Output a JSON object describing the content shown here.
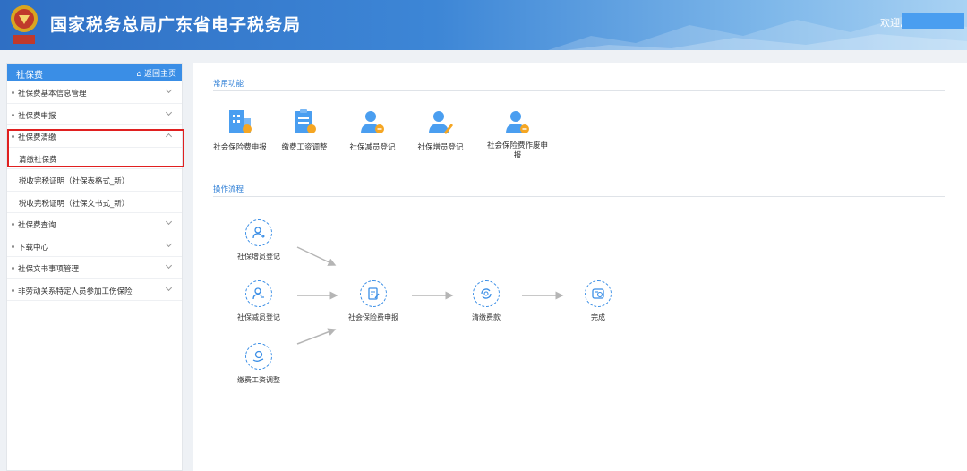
{
  "header": {
    "title": "国家税务总局广东省电子税务局",
    "welcome": "欢迎,"
  },
  "sidebar": {
    "title": "社保费",
    "home": "⌂ 返回主页",
    "items": [
      {
        "label": "社保费基本信息管理"
      },
      {
        "label": "社保费申报"
      },
      {
        "label": "社保费清缴"
      },
      {
        "label": "清缴社保费"
      },
      {
        "label": "税收完税证明（社保表格式_新）"
      },
      {
        "label": "税收完税证明（社保文书式_新）"
      },
      {
        "label": "社保费查询"
      },
      {
        "label": "下载中心"
      },
      {
        "label": "社保文书事项管理"
      },
      {
        "label": "非劳动关系特定人员参加工伤保险"
      }
    ]
  },
  "main": {
    "common_title": "常用功能",
    "functions": [
      {
        "label": "社会保险费申报",
        "icon": "building-icon"
      },
      {
        "label": "缴费工资调整",
        "icon": "clipboard-icon"
      },
      {
        "label": "社保减员登记",
        "icon": "user-minus-icon"
      },
      {
        "label": "社保增员登记",
        "icon": "user-edit-icon"
      },
      {
        "label": "社会保险费作废申报",
        "icon": "user-cancel-icon"
      }
    ],
    "flow_title": "操作流程",
    "flow": {
      "add": "社保增员登记",
      "reduce": "社保减员登记",
      "wage": "缴费工资调整",
      "declare": "社会保险费申报",
      "pay": "清缴费款",
      "done": "完成"
    }
  },
  "colors": {
    "accent": "#3a8ee6",
    "highlight": "#e02020"
  }
}
